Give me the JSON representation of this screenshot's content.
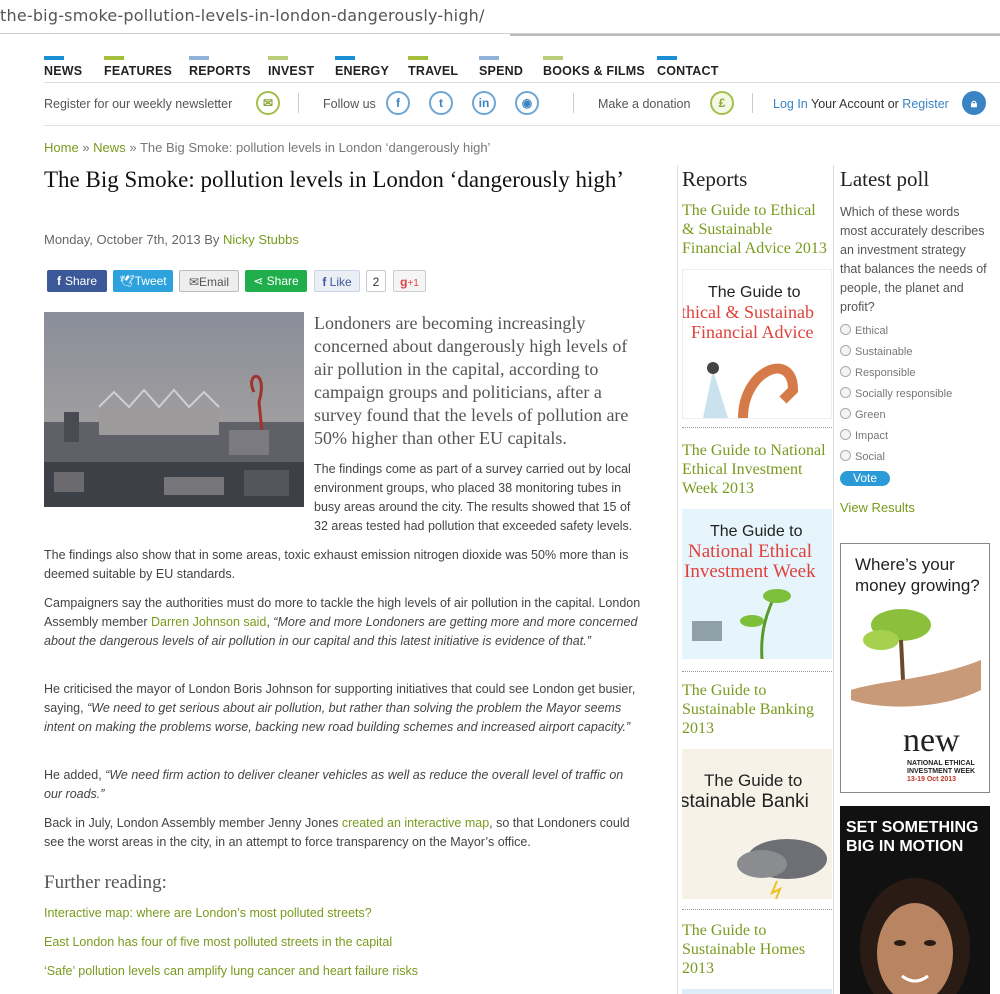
{
  "browser": {
    "url": "the-big-smoke-pollution-levels-in-london-dangerously-high/"
  },
  "nav": {
    "items": [
      {
        "label": "NEWS",
        "color": "#1a8fd3"
      },
      {
        "label": "FEATURES",
        "color": "#a3bf3b"
      },
      {
        "label": "REPORTS",
        "color": "#8fb2d8"
      },
      {
        "label": "INVEST",
        "color": "#b8cf77"
      },
      {
        "label": "ENERGY",
        "color": "#1a8fd3"
      },
      {
        "label": "TRAVEL",
        "color": "#a3bf3b"
      },
      {
        "label": "SPEND",
        "color": "#8fb2d8"
      },
      {
        "label": "BOOKS & FILMS",
        "color": "#b8cf77"
      },
      {
        "label": "CONTACT",
        "color": "#1a8fd3"
      }
    ]
  },
  "util": {
    "newsletter": "Register for our weekly newsletter",
    "follow": "Follow us",
    "donation": "Make a donation",
    "login": "Log In",
    "account": "Your Account or",
    "register": "Register"
  },
  "breadcrumb": {
    "home": "Home",
    "sep": "»",
    "news": "News",
    "current": "The Big Smoke: pollution levels in London ‘dangerously high’"
  },
  "article": {
    "title": "The Big Smoke: pollution levels in London ‘dangerously high’",
    "date": "Monday, October 7th, 2013 By",
    "author": "Nicky Stubbs",
    "share": {
      "fb": "Share",
      "tw": "Tweet",
      "email": "Email",
      "share": "Share",
      "like": "Like",
      "like_count": "2",
      "gplus": "+1"
    },
    "lead": "Londoners are becoming increasingly concerned about dangerously high levels of air pollution in the capital, according to campaign groups and politicians, after a survey found that the levels of pollution are 50% higher than other EU capitals.",
    "p1": "The findings come as part of a survey carried out by local environment groups, who placed 38 monitoring tubes in busy areas around the city. The results showed that 15 of 32 areas tested had pollution that exceeded safety levels.",
    "p2": "The findings also show that in some areas, toxic exhaust emission nitrogen dioxide was 50% more than is deemed suitable by EU standards.",
    "p3a": "Campaigners say the authorities must do more to tackle the high levels of air pollution in the capital. London Assembly member",
    "p3link": "Darren Johnson said",
    "p3q": "“More and more Londoners are getting more and more concerned about the dangerous levels of air pollution in our capital and this latest initiative is evidence of that.”",
    "p4a": "He criticised the mayor of London Boris Johnson for supporting initiatives that could see London get busier, saying,",
    "p4q": "“We need to get serious about air pollution, but rather than solving the problem the Mayor seems intent on making the problems worse, backing new road building schemes and increased airport capacity.”",
    "p5a": "He added,",
    "p5q": "“We need firm action to deliver cleaner vehicles as well as reduce the overall level of traffic on our roads.”",
    "p6a": "Back in July, London Assembly member Jenny Jones",
    "p6link": "created an interactive map",
    "p6b": ", so that Londoners could see the worst areas in the city, in an attempt to force transparency on the Mayor’s office.",
    "further_title": "Further reading:",
    "further": [
      "Interactive map: where are London’s most polluted streets?",
      "East London has four of five most polluted streets in the capital",
      "‘Safe’ pollution levels can amplify lung cancer and heart failure risks"
    ]
  },
  "reports": {
    "heading": "Reports",
    "items": [
      {
        "title": "The Guide to Ethical & Sustainable Financial Advice 2013",
        "cover_a": "The Guide to",
        "cover_b": "thical & Sustainab",
        "cover_c": "Financial Advice",
        "cover_bg": "#ffffff",
        "cover_accent": "#e0413b"
      },
      {
        "title": "The Guide to National Ethical Investment Week 2013",
        "cover_a": "The Guide to",
        "cover_b": "National Ethical",
        "cover_c": "Investment Week",
        "cover_bg": "#eaf6fb",
        "cover_accent": "#e0413b"
      },
      {
        "title": "The Guide to Sustainable Banking 2013",
        "cover_a": "The Guide to",
        "cover_b": "stainable Banki",
        "cover_c": "",
        "cover_bg": "#f6f2e8",
        "cover_accent": "#e0413b"
      },
      {
        "title": "The Guide to Sustainable Homes 2013",
        "cover_a": "",
        "cover_b": "",
        "cover_c": "",
        "cover_bg": "#dfeef6",
        "cover_accent": "#e0413b"
      }
    ]
  },
  "poll": {
    "heading": "Latest poll",
    "question": "Which of these words most accurately describes an investment strategy that balances the needs of people, the planet and profit?",
    "options": [
      "Ethical",
      "Sustainable",
      "Responsible",
      "Socially responsible",
      "Green",
      "Impact",
      "Social"
    ],
    "vote": "Vote",
    "view_results": "View Results"
  },
  "ads": {
    "ad1_line1": "Where’s your",
    "ad1_line2": "money growing?",
    "ad1_logo": "new",
    "ad1_sub1": "NATIONAL ETHICAL",
    "ad1_sub2": "INVESTMENT WEEK",
    "ad1_dates": "13-19 Oct 2013",
    "ad2_line1": "SET SOMETHING",
    "ad2_line2": "BIG IN MOTION"
  }
}
